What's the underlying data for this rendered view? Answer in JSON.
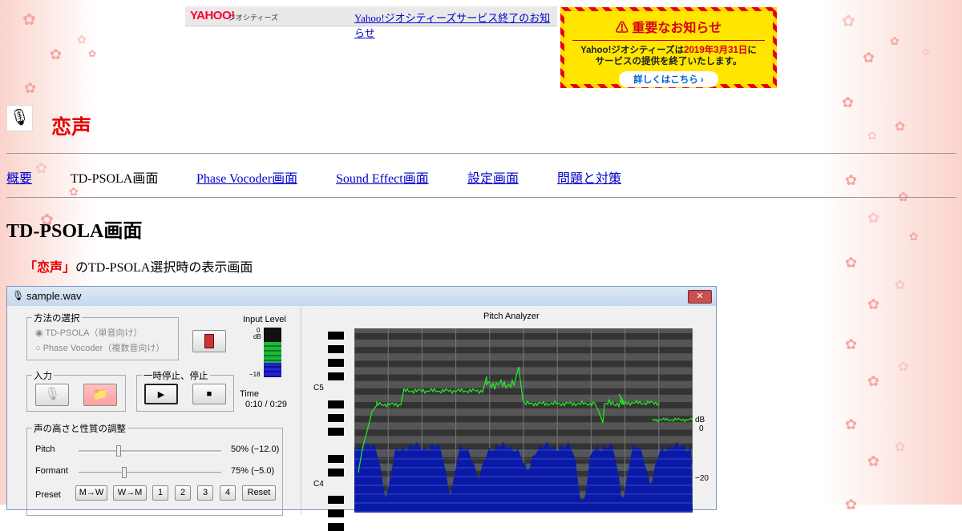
{
  "yahoo": {
    "logo": "YAHOO!",
    "sub": "ジオシティーズ",
    "link": "Yahoo!ジオシティーズサービス終了のお知らせ"
  },
  "notice": {
    "title": "重要なお知らせ",
    "body_1": "Yahoo!ジオシティーズは",
    "body_date": "2019年3月31日",
    "body_2": "に",
    "body_3": "サービスの提供を終了いたします。",
    "button": "詳しくはこちら ›"
  },
  "site_title": "恋声",
  "nav": [
    {
      "label": "概要",
      "link": true
    },
    {
      "label": "TD-PSOLA画面",
      "link": false
    },
    {
      "label": "Phase Vocoder画面",
      "link": true
    },
    {
      "label": "Sound Effect画面",
      "link": true
    },
    {
      "label": "設定画面",
      "link": true
    },
    {
      "label": "問題と対策",
      "link": true
    }
  ],
  "heading": "TD-PSOLA画面",
  "caption": {
    "em": "「恋声」",
    "text": "のTD-PSOLA選択時の表示画面"
  },
  "app": {
    "window_title": "sample.wav",
    "close": "✕",
    "method_group": "方法の選択",
    "method_options": [
      "TD-PSOLA（単音向け）",
      "Phase Vocoder（複数音向け）"
    ],
    "input_level_label": "Input Level",
    "level_top": "0",
    "level_unit": "dB",
    "level_bottom": "−18",
    "input_group": "入力",
    "pause_group": "一時停止、停止",
    "time_label": "Time",
    "time_value": "0:10 / 0:29",
    "adjust_group": "声の高さと性質の調整",
    "pitch_label": "Pitch",
    "pitch_value": "50% (−12.0)",
    "formant_label": "Formant",
    "formant_value": "75% (−5.0)",
    "preset_label": "Preset",
    "preset_buttons": [
      "M→W",
      "W→M",
      "1",
      "2",
      "3",
      "4",
      "Reset"
    ],
    "analyzer_title": "Pitch Analyzer",
    "note_c5": "C5",
    "note_c4": "C4",
    "db_unit": "dB",
    "db_0": "0",
    "db_m20": "−20",
    "colors": {
      "pitch_line": "#22ee22",
      "spectrum": "#0a1aa8",
      "record_button": "#e05050"
    }
  }
}
